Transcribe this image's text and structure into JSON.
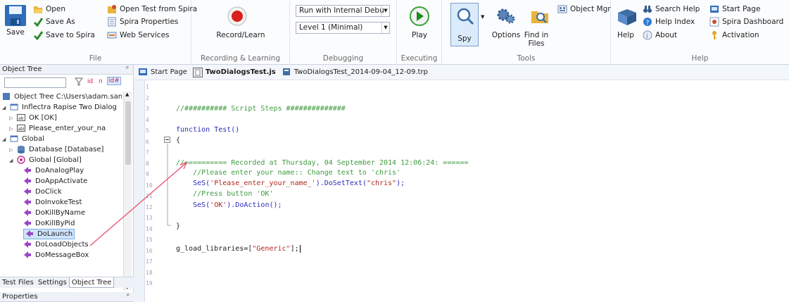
{
  "ribbon": {
    "file": {
      "label": "File",
      "save": "Save",
      "open": "Open",
      "save_as": "Save As",
      "save_to_spira": "Save to Spira",
      "open_test_from_spira": "Open Test from Spira",
      "spira_properties": "Spira Properties",
      "web_services": "Web Services"
    },
    "recording": {
      "label": "Recording & Learning",
      "record_learn": "Record/Learn"
    },
    "debugging": {
      "label": "Debugging",
      "run_mode": "Run with Internal Debu",
      "log_level": "Level 1 (Minimal)"
    },
    "executing": {
      "label": "Executing",
      "play": "Play"
    },
    "tools": {
      "label": "Tools",
      "spy": "Spy",
      "options": "Options",
      "find_in_files": "Find in Files",
      "object_mgr": "Object Mgr"
    },
    "help": {
      "label": "Help",
      "help": "Help",
      "search_help": "Search Help",
      "help_index": "Help Index",
      "about": "About",
      "start_page": "Start Page",
      "spira_dashboard": "Spira Dashboard",
      "activation": "Activation"
    }
  },
  "object_tree": {
    "title": "Object Tree",
    "filter_id": "id",
    "filter_n": "n",
    "filter_idx": "id#",
    "root": "Object Tree C:\\Users\\adam.san",
    "nodes": [
      "Inflectra Rapise Two Dialog",
      "OK [OK]",
      "Please_enter_your_na",
      "Global",
      "Database [Database]",
      "Global [Global]",
      "DoAnalogPlay",
      "DoAppActivate",
      "DoClick",
      "DoInvokeTest",
      "DoKillByName",
      "DoKillByPid",
      "DoLaunch",
      "DoLoadObjects",
      "DoMessageBox"
    ],
    "tabs": [
      "Test Files",
      "Settings",
      "Object Tree"
    ],
    "properties_title": "Properties"
  },
  "doc_tabs": [
    "Start Page",
    "TwoDialogsTest.js",
    "TwoDialogsTest_2014-09-04_12-09.trp"
  ],
  "editor": {
    "line_numbers": [
      "1",
      "2",
      "3",
      "4",
      "5",
      "6",
      "7",
      "8",
      "9",
      "10",
      "11",
      "12",
      "13",
      "14",
      "15",
      "16",
      "17",
      "18",
      "19"
    ],
    "lines": {
      "l3": "//########## Script Steps ##############",
      "l5_kw": "function",
      "l5_rest": " Test()",
      "l6": "{",
      "l8": "//========== Recorded at Thursday, 04 September 2014 12:06:24: ======",
      "l9": "    //Please enter your name:: Change text to 'chris'",
      "l10_fn": "    SeS(",
      "l10_s1": "'Please_enter_your_name_'",
      "l10_mid": ").DoSetText(",
      "l10_s2": "\"chris\"",
      "l10_end": ");",
      "l11": "    //Press button 'OK'",
      "l12_fn": "    SeS(",
      "l12_s1": "'OK'",
      "l12_end": ").DoAction();",
      "l14": "}",
      "l16_a": "g_load_libraries=[",
      "l16_s": "\"Generic\"",
      "l16_b": "];"
    }
  },
  "colors": {
    "comment": "#3f9a3f",
    "keyword": "#2b2bbb",
    "string": "#b0281e",
    "annotation_arrow": "#e8506a"
  }
}
